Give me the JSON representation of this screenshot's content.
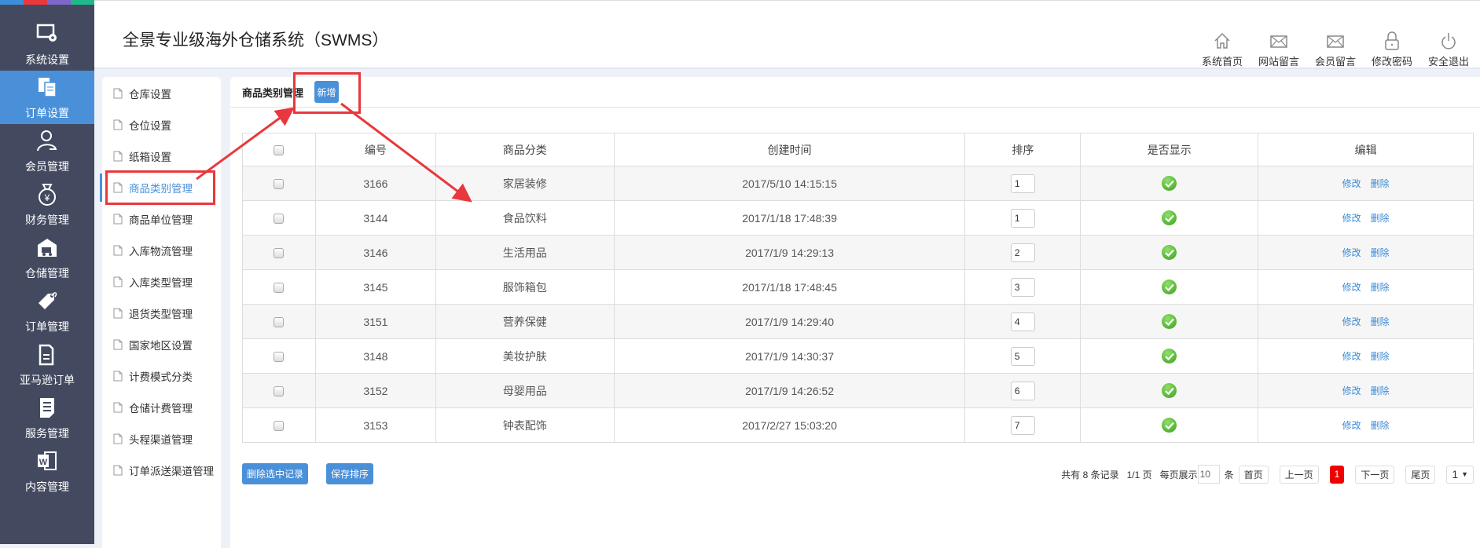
{
  "strip_colors": [
    "#3b8fdb",
    "#e8383d",
    "#7b68c8",
    "#1fb98a"
  ],
  "sidebar": {
    "items": [
      {
        "label": "系统设置",
        "icon": "monitor-gear-icon"
      },
      {
        "label": "订单设置",
        "icon": "documents-icon",
        "active": true
      },
      {
        "label": "会员管理",
        "icon": "user-icon"
      },
      {
        "label": "财务管理",
        "icon": "money-bag-icon"
      },
      {
        "label": "仓储管理",
        "icon": "warehouse-truck-icon"
      },
      {
        "label": "订单管理",
        "icon": "tag-icon"
      },
      {
        "label": "亚马逊订单",
        "icon": "file-copy-icon"
      },
      {
        "label": "服务管理",
        "icon": "note-icon"
      },
      {
        "label": "内容管理",
        "icon": "word-doc-icon"
      }
    ]
  },
  "header": {
    "title": "全景专业级海外仓储系统（SWMS）",
    "links": [
      {
        "label": "系统首页",
        "icon": "home-icon"
      },
      {
        "label": "网站留言",
        "icon": "mail-icon"
      },
      {
        "label": "会员留言",
        "icon": "mail-icon"
      },
      {
        "label": "修改密码",
        "icon": "lock-icon"
      },
      {
        "label": "安全退出",
        "icon": "power-icon"
      }
    ]
  },
  "submenu": {
    "items": [
      "仓库设置",
      "仓位设置",
      "纸箱设置",
      "商品类别管理",
      "商品单位管理",
      "入库物流管理",
      "入库类型管理",
      "退货类型管理",
      "国家地区设置",
      "计费模式分类",
      "仓储计费管理",
      "头程渠道管理",
      "订单派送渠道管理"
    ],
    "active_index": 3
  },
  "main": {
    "title": "商品类别管理",
    "add_label": "新增",
    "columns": [
      "",
      "编号",
      "商品分类",
      "创建时间",
      "排序",
      "是否显示",
      "编辑"
    ],
    "rows": [
      {
        "id": "3166",
        "category": "家居装修",
        "created": "2017/5/10 14:15:15",
        "sort": "1",
        "shown": true
      },
      {
        "id": "3144",
        "category": "食品饮料",
        "created": "2017/1/18 17:48:39",
        "sort": "1",
        "shown": true
      },
      {
        "id": "3146",
        "category": "生活用品",
        "created": "2017/1/9 14:29:13",
        "sort": "2",
        "shown": true
      },
      {
        "id": "3145",
        "category": "服饰箱包",
        "created": "2017/1/18 17:48:45",
        "sort": "3",
        "shown": true
      },
      {
        "id": "3151",
        "category": "营养保健",
        "created": "2017/1/9 14:29:40",
        "sort": "4",
        "shown": true
      },
      {
        "id": "3148",
        "category": "美妆护肤",
        "created": "2017/1/9 14:30:37",
        "sort": "5",
        "shown": true
      },
      {
        "id": "3152",
        "category": "母婴用品",
        "created": "2017/1/9 14:26:52",
        "sort": "6",
        "shown": true
      },
      {
        "id": "3153",
        "category": "钟表配饰",
        "created": "2017/2/27 15:03:20",
        "sort": "7",
        "shown": true
      }
    ],
    "edit_label": "修改",
    "delete_label": "删除",
    "delete_selected_label": "删除选中记录",
    "save_sort_label": "保存排序"
  },
  "pager": {
    "total_text": "共有 8 条记录",
    "page_text": "1/1 页",
    "per_page_label": "每页展示",
    "per_page": "10",
    "unit": "条",
    "first": "首页",
    "prev": "上一页",
    "current": "1",
    "next": "下一页",
    "last": "尾页",
    "select_value": "1"
  },
  "annotation_color": "#e8383d"
}
